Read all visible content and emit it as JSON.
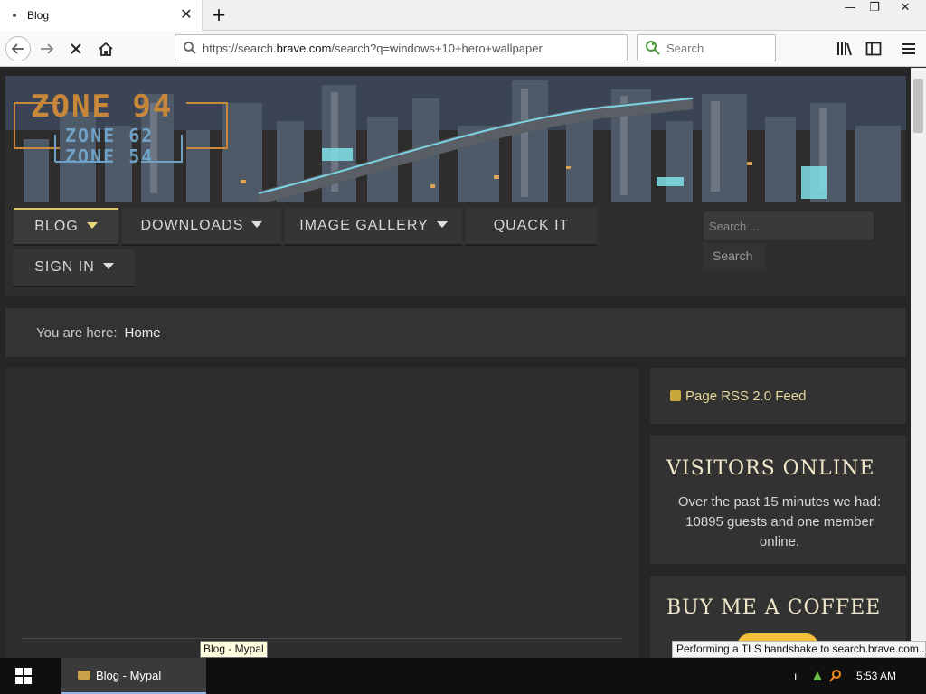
{
  "browser": {
    "tab_title": "Blog",
    "url_prefix": "https://search.",
    "url_domain": "brave.com",
    "url_rest": "/search?q=windows+10+hero+wallpaper",
    "search_placeholder": "Search"
  },
  "site": {
    "logo_main": "ZONE 94",
    "logo_sub1": "ZONE 62",
    "logo_sub2": "ZONE 54",
    "menu": [
      {
        "label": "BLOG",
        "has_caret": true,
        "active": true
      },
      {
        "label": "DOWNLOADS",
        "has_caret": true,
        "active": false
      },
      {
        "label": "IMAGE GALLERY",
        "has_caret": true,
        "active": false
      },
      {
        "label": "QUACK IT",
        "has_caret": false,
        "active": false
      },
      {
        "label": "SIGN IN",
        "has_caret": true,
        "active": false
      }
    ],
    "search_placeholder": "Search ...",
    "search_button": "Search",
    "breadcrumb_prefix": "You are here:",
    "breadcrumb_current": "Home",
    "rss_label": "Page RSS 2.0 Feed",
    "visitors_heading": "VISITORS ONLINE",
    "visitors_text": "Over the past 15 minutes we had: 10895 guests and one member online.",
    "coffee_heading": "BUY ME A COFFEE"
  },
  "tooltip": "Blog - Mypal",
  "status": "Performing a TLS handshake to search.brave.com...",
  "taskbar": {
    "app_label": "Blog - Mypal",
    "clock": "5:53 AM"
  },
  "colors": {
    "accent": "#d9c86a",
    "logo": "#c9873a",
    "logo_sub": "#6fa2c6",
    "heading": "#f0e6c8"
  }
}
